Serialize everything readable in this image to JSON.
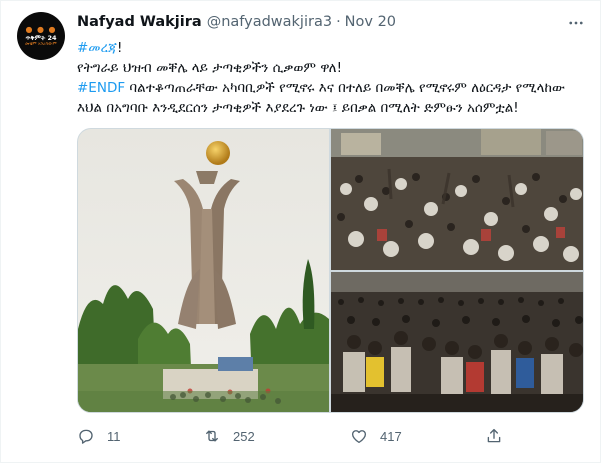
{
  "author": {
    "name": "Nafyad Wakjira",
    "handle": "@nafyadwakjira3",
    "separator": "·",
    "time": "Nov 20",
    "avatar_text": "ጥቅምት 24",
    "avatar_subtext": "መቼም አንረሳውም"
  },
  "tweet": {
    "line1_hashtag": "#መረጃ",
    "line1_rest": "!",
    "line2": "የትግራይ ህዝብ መቐሌ ላይ ታጣቂዎችን ሲቃወም ዋለ!",
    "line3_hashtag": "#ENDF",
    "line3_rest": " ባልተቆጣጠራቸው አካባቢዎች የሚኖሩ እና በተለይ በመቐሌ የሚኖሩም ለዕርዳታ የሚላከው",
    "line4": "እህል በአግባቡ እንዲደርሰን ታጣቂዎች እያደረጉ ነው ፤ ይበቃል በሚለት ድምፁን አሰምቷል!"
  },
  "media": {
    "images": [
      "monument-photo",
      "crowd-photo-top",
      "crowd-photo-bottom"
    ]
  },
  "actions": {
    "reply_count": "11",
    "retweet_count": "252",
    "like_count": "417"
  },
  "colors": {
    "accent": "#1d9bf0",
    "secondary_text": "#536471",
    "primary_text": "#0f1419",
    "border": "#cfd9de"
  }
}
